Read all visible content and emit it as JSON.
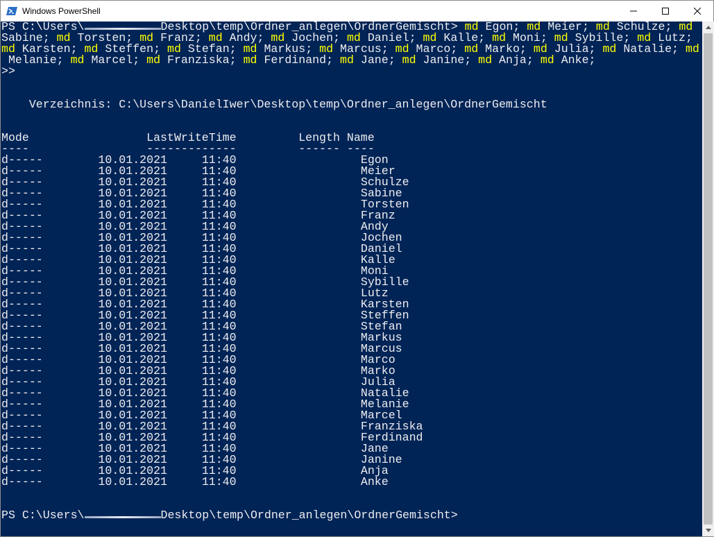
{
  "window": {
    "title": "Windows PowerShell",
    "icon": "powershell-icon",
    "buttons": {
      "minimize": "minimize-icon",
      "maximize": "maximize-icon",
      "close": "close-icon"
    }
  },
  "console": {
    "prompt_prefix": "PS C:\\Users\\",
    "prompt_path": "Desktop\\temp\\Ordner_anlegen\\OrdnerGemischt>",
    "command_lines": [
      [
        {
          "t": " "
        },
        {
          "t": "md",
          "k": 1
        },
        {
          "t": " Egon; "
        },
        {
          "t": "md",
          "k": 1
        },
        {
          "t": " Meier; "
        },
        {
          "t": "md",
          "k": 1
        },
        {
          "t": " Schulze; "
        },
        {
          "t": "md",
          "k": 1
        }
      ],
      [
        {
          "t": "Sabine; "
        },
        {
          "t": "md",
          "k": 1
        },
        {
          "t": " Torsten; "
        },
        {
          "t": "md",
          "k": 1
        },
        {
          "t": " Franz; "
        },
        {
          "t": "md",
          "k": 1
        },
        {
          "t": " Andy; "
        },
        {
          "t": "md",
          "k": 1
        },
        {
          "t": " Jochen; "
        },
        {
          "t": "md",
          "k": 1
        },
        {
          "t": " Daniel; "
        },
        {
          "t": "md",
          "k": 1
        },
        {
          "t": " Kalle; "
        },
        {
          "t": "md",
          "k": 1
        },
        {
          "t": " Moni; "
        },
        {
          "t": "md",
          "k": 1
        },
        {
          "t": " Sybille; "
        },
        {
          "t": "md",
          "k": 1
        },
        {
          "t": " Lutz;"
        }
      ],
      [
        {
          "t": "md",
          "k": 1
        },
        {
          "t": " Karsten; "
        },
        {
          "t": "md",
          "k": 1
        },
        {
          "t": " Steffen; "
        },
        {
          "t": "md",
          "k": 1
        },
        {
          "t": " Stefan; "
        },
        {
          "t": "md",
          "k": 1
        },
        {
          "t": " Markus; "
        },
        {
          "t": "md",
          "k": 1
        },
        {
          "t": " Marcus; "
        },
        {
          "t": "md",
          "k": 1
        },
        {
          "t": " Marco; "
        },
        {
          "t": "md",
          "k": 1
        },
        {
          "t": " Marko; "
        },
        {
          "t": "md",
          "k": 1
        },
        {
          "t": " Julia; "
        },
        {
          "t": "md",
          "k": 1
        },
        {
          "t": " Natalie; "
        },
        {
          "t": "md",
          "k": 1
        }
      ],
      [
        {
          "t": " Melanie; "
        },
        {
          "t": "md",
          "k": 1
        },
        {
          "t": " Marcel; "
        },
        {
          "t": "md",
          "k": 1
        },
        {
          "t": " Franziska; "
        },
        {
          "t": "md",
          "k": 1
        },
        {
          "t": " Ferdinand; "
        },
        {
          "t": "md",
          "k": 1
        },
        {
          "t": " Jane; "
        },
        {
          "t": "md",
          "k": 1
        },
        {
          "t": " Janine; "
        },
        {
          "t": "md",
          "k": 1
        },
        {
          "t": " Anja; "
        },
        {
          "t": "md",
          "k": 1
        },
        {
          "t": " Anke;"
        }
      ]
    ],
    "continuation": ">>",
    "directory_label": "    Verzeichnis: C:\\Users\\DanielIwer\\Desktop\\temp\\Ordner_anlegen\\OrdnerGemischt",
    "header_line": "Mode                 LastWriteTime         Length Name",
    "header_rule": "----                 -------------         ------ ----",
    "row_mode": "d-----",
    "row_date": "10.01.2021",
    "row_time": "11:40",
    "folders": [
      "Egon",
      "Meier",
      "Schulze",
      "Sabine",
      "Torsten",
      "Franz",
      "Andy",
      "Jochen",
      "Daniel",
      "Kalle",
      "Moni",
      "Sybille",
      "Lutz",
      "Karsten",
      "Steffen",
      "Stefan",
      "Markus",
      "Marcus",
      "Marco",
      "Marko",
      "Julia",
      "Natalie",
      "Melanie",
      "Marcel",
      "Franziska",
      "Ferdinand",
      "Jane",
      "Janine",
      "Anja",
      "Anke"
    ]
  },
  "scrollbar": {
    "up": "scroll-up-arrow-icon",
    "down": "scroll-down-arrow-icon"
  }
}
